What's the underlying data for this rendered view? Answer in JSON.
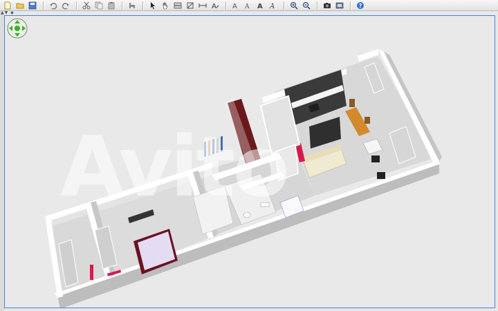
{
  "toolbar": {
    "buttons": [
      {
        "icon": "new-file-icon"
      },
      {
        "icon": "open-folder-icon"
      },
      {
        "icon": "save-icon"
      },
      {
        "icon": "undo-icon"
      },
      {
        "icon": "redo-icon"
      },
      {
        "icon": "cut-icon"
      },
      {
        "icon": "copy-icon"
      },
      {
        "icon": "paste-icon"
      },
      {
        "icon": "add-furniture-icon"
      },
      {
        "icon": "select-arrow-icon"
      },
      {
        "icon": "pan-hand-icon"
      },
      {
        "icon": "create-walls-icon"
      },
      {
        "icon": "create-rooms-icon"
      },
      {
        "icon": "create-dimensions-icon"
      },
      {
        "icon": "create-labels-icon"
      },
      {
        "icon": "text-style-a1-icon"
      },
      {
        "icon": "text-style-a2-icon"
      },
      {
        "icon": "text-style-a3-icon"
      },
      {
        "icon": "text-style-a4-icon"
      },
      {
        "icon": "zoom-in-icon"
      },
      {
        "icon": "zoom-out-icon"
      },
      {
        "icon": "create-photo-icon"
      },
      {
        "icon": "create-video-icon"
      },
      {
        "icon": "help-icon"
      }
    ]
  },
  "colors": {
    "accent": "#4a7ed8",
    "wall_top": "#ffffff",
    "wall_side": "#c9c9c9",
    "floor": "#d4d4d4",
    "navigator": "#3fae2a"
  },
  "watermark": "Avito",
  "gutter_marks": "▲▼ ◆"
}
